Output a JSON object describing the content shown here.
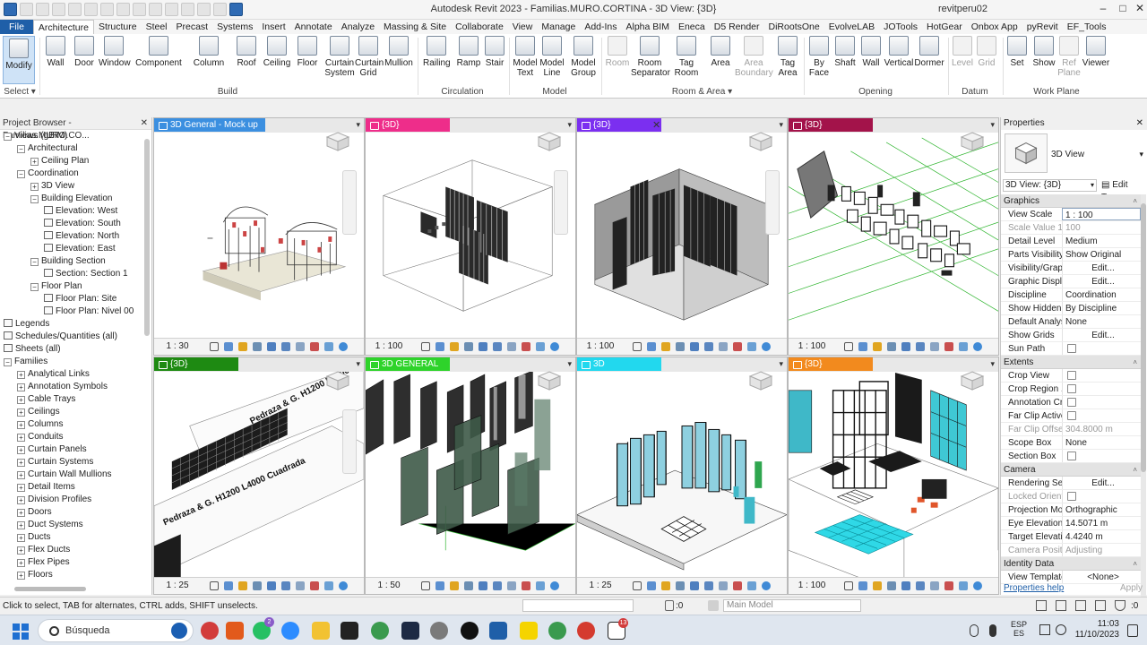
{
  "window": {
    "title": "Autodesk Revit 2023 - Familias.MURO.CORTINA - 3D View: {3D}",
    "user": "revitperu02",
    "min": "–",
    "max": "□",
    "close": "✕"
  },
  "ribbon_tabs": [
    "File",
    "Architecture",
    "Structure",
    "Steel",
    "Precast",
    "Systems",
    "Insert",
    "Annotate",
    "Analyze",
    "Massing & Site",
    "Collaborate",
    "View",
    "Manage",
    "Add-Ins",
    "Alpha BIM",
    "Eneca",
    "D5 Render",
    "DiRootsOne",
    "EvolveLAB",
    "JOTools",
    "HotGear",
    "Onbox App",
    "pyRevit",
    "EF_Tools"
  ],
  "ribbon_active": "Architecture",
  "tools": {
    "modify": "Modify",
    "wall": "Wall",
    "door": "Door",
    "window": "Window",
    "component": "Component",
    "column": "Column",
    "roof": "Roof",
    "ceiling": "Ceiling",
    "floor": "Floor",
    "curtain_system": "Curtain\nSystem",
    "curtain_grid": "Curtain\nGrid",
    "mullion": "Mullion",
    "railing": "Railing",
    "ramp": "Ramp",
    "stair": "Stair",
    "model_text": "Model\nText",
    "model_line": "Model\nLine",
    "model_group": "Model\nGroup",
    "room": "Room",
    "room_separator": "Room\nSeparator",
    "tag_room": "Tag\nRoom",
    "area": "Area",
    "area_boundary": "Area\nBoundary",
    "tag_area": "Tag\nArea",
    "by_face": "By\nFace",
    "shaft": "Shaft",
    "wall_op": "Wall",
    "vertical": "Vertical",
    "dormer": "Dormer",
    "level": "Level",
    "grid": "Grid",
    "set": "Set",
    "show": "Show",
    "ref_plane": "Ref\nPlane",
    "viewer": "Viewer"
  },
  "panels": {
    "select": "Select ▾",
    "build": "Build",
    "circulation": "Circulation",
    "model": "Model",
    "room_area": "Room & Area ▾",
    "opening": "Opening",
    "datum": "Datum",
    "work_plane": "Work Plane"
  },
  "project_browser": {
    "title": "Project Browser - Familias.MURO.CO...",
    "close": "✕",
    "items": [
      {
        "label": "Views (gBIM)",
        "exp": "−"
      },
      {
        "label": "Architectural",
        "exp": "−"
      },
      {
        "label": "Ceiling Plan",
        "exp": "+"
      },
      {
        "label": "Coordination",
        "exp": "−"
      },
      {
        "label": "3D View",
        "exp": "+"
      },
      {
        "label": "Building Elevation",
        "exp": "−"
      },
      {
        "label": "Elevation: West",
        "exp": ""
      },
      {
        "label": "Elevation: South",
        "exp": ""
      },
      {
        "label": "Elevation: North",
        "exp": ""
      },
      {
        "label": "Elevation: East",
        "exp": ""
      },
      {
        "label": "Building Section",
        "exp": "−"
      },
      {
        "label": "Section: Section 1",
        "exp": ""
      },
      {
        "label": "Floor Plan",
        "exp": "−"
      },
      {
        "label": "Floor Plan: Site",
        "exp": ""
      },
      {
        "label": "Floor Plan: Nivel 00",
        "exp": ""
      },
      {
        "label": "Legends",
        "exp": ""
      },
      {
        "label": "Schedules/Quantities (all)",
        "exp": ""
      },
      {
        "label": "Sheets (all)",
        "exp": ""
      },
      {
        "label": "Families",
        "exp": "−"
      },
      {
        "label": "Analytical Links",
        "exp": "+"
      },
      {
        "label": "Annotation Symbols",
        "exp": "+"
      },
      {
        "label": "Cable Trays",
        "exp": "+"
      },
      {
        "label": "Ceilings",
        "exp": "+"
      },
      {
        "label": "Columns",
        "exp": "+"
      },
      {
        "label": "Conduits",
        "exp": "+"
      },
      {
        "label": "Curtain Panels",
        "exp": "+"
      },
      {
        "label": "Curtain Systems",
        "exp": "+"
      },
      {
        "label": "Curtain Wall Mullions",
        "exp": "+"
      },
      {
        "label": "Detail Items",
        "exp": "+"
      },
      {
        "label": "Division Profiles",
        "exp": "+"
      },
      {
        "label": "Doors",
        "exp": "+"
      },
      {
        "label": "Duct Systems",
        "exp": "+"
      },
      {
        "label": "Ducts",
        "exp": "+"
      },
      {
        "label": "Flex Ducts",
        "exp": "+"
      },
      {
        "label": "Flex Pipes",
        "exp": "+"
      },
      {
        "label": "Floors",
        "exp": "+"
      }
    ]
  },
  "viewports": [
    {
      "label": "3D General - Mock up",
      "color": "#3b8fe0",
      "scale": "1 : 30"
    },
    {
      "label": "{3D}",
      "color": "#ee2d8a",
      "scale": "1 : 100"
    },
    {
      "label": "{3D}",
      "color": "#7b2ff0",
      "scale": "1 : 100",
      "close": "✕"
    },
    {
      "label": "{3D}",
      "color": "#a3134a",
      "scale": "1 : 100"
    },
    {
      "label": "{3D}",
      "color": "#1e8a12",
      "scale": "1 : 25"
    },
    {
      "label": "3D GENERAL",
      "color": "#2ed32a",
      "scale": "1 : 50"
    },
    {
      "label": "3D",
      "color": "#22d8ee",
      "scale": "1 : 25"
    },
    {
      "label": "{3D}",
      "color": "#f28a1e",
      "scale": "1 : 100"
    }
  ],
  "viewport_menu": "▾",
  "annotations": {
    "vp5_text": "Pedraza & G. H1200 L4000 Cuadrada"
  },
  "properties": {
    "title": "Properties",
    "close": "✕",
    "type_name": "3D View",
    "view_selector": "3D View: {3D}",
    "edit_type": "Edit Type",
    "help": "Properties help",
    "apply": "Apply",
    "rows": [
      {
        "group": "Graphics"
      },
      {
        "k": "View Scale",
        "v": "1 : 100",
        "kind": "input"
      },
      {
        "k": "Scale Value    1:",
        "v": "100",
        "kind": "ro"
      },
      {
        "k": "Detail Level",
        "v": "Medium"
      },
      {
        "k": "Parts Visibility",
        "v": "Show Original"
      },
      {
        "k": "Visibility/Grap...",
        "v": "Edit...",
        "kind": "btn"
      },
      {
        "k": "Graphic Displa...",
        "v": "Edit...",
        "kind": "btn"
      },
      {
        "k": "Discipline",
        "v": "Coordination"
      },
      {
        "k": "Show Hidden ...",
        "v": "By Discipline"
      },
      {
        "k": "Default Analys...",
        "v": "None"
      },
      {
        "k": "Show Grids",
        "v": "Edit...",
        "kind": "btn"
      },
      {
        "k": "Sun Path",
        "v": "",
        "kind": "box"
      },
      {
        "group": "Extents"
      },
      {
        "k": "Crop View",
        "v": "",
        "kind": "box"
      },
      {
        "k": "Crop Region ...",
        "v": "",
        "kind": "box"
      },
      {
        "k": "Annotation Cr...",
        "v": "",
        "kind": "box"
      },
      {
        "k": "Far Clip Active",
        "v": "",
        "kind": "box"
      },
      {
        "k": "Far Clip Offset",
        "v": "304.8000 m",
        "kind": "ro"
      },
      {
        "k": "Scope Box",
        "v": "None"
      },
      {
        "k": "Section Box",
        "v": "",
        "kind": "box"
      },
      {
        "group": "Camera"
      },
      {
        "k": "Rendering Set...",
        "v": "Edit...",
        "kind": "btn"
      },
      {
        "k": "Locked Orient...",
        "v": "",
        "kind": "robox"
      },
      {
        "k": "Projection Mo...",
        "v": "Orthographic"
      },
      {
        "k": "Eye Elevation",
        "v": "14.5071 m"
      },
      {
        "k": "Target Elevation",
        "v": "4.4240 m"
      },
      {
        "k": "Camera Positi...",
        "v": "Adjusting",
        "kind": "ro"
      },
      {
        "group": "Identity Data"
      },
      {
        "k": "View Template",
        "v": "<None>",
        "kind": "btn"
      }
    ]
  },
  "status": {
    "text": "Click to select, TAB for alternates, CTRL adds, SHIFT unselects.",
    "zero1": ":0",
    "main_model": "Main Model",
    "filter": ":0"
  },
  "taskbar": {
    "search": "Búsqueda",
    "lang": "ESP\nES",
    "time": "11:03",
    "date": "11/10/2023",
    "badge_whatsapp": "2",
    "badge_notion": "13"
  }
}
